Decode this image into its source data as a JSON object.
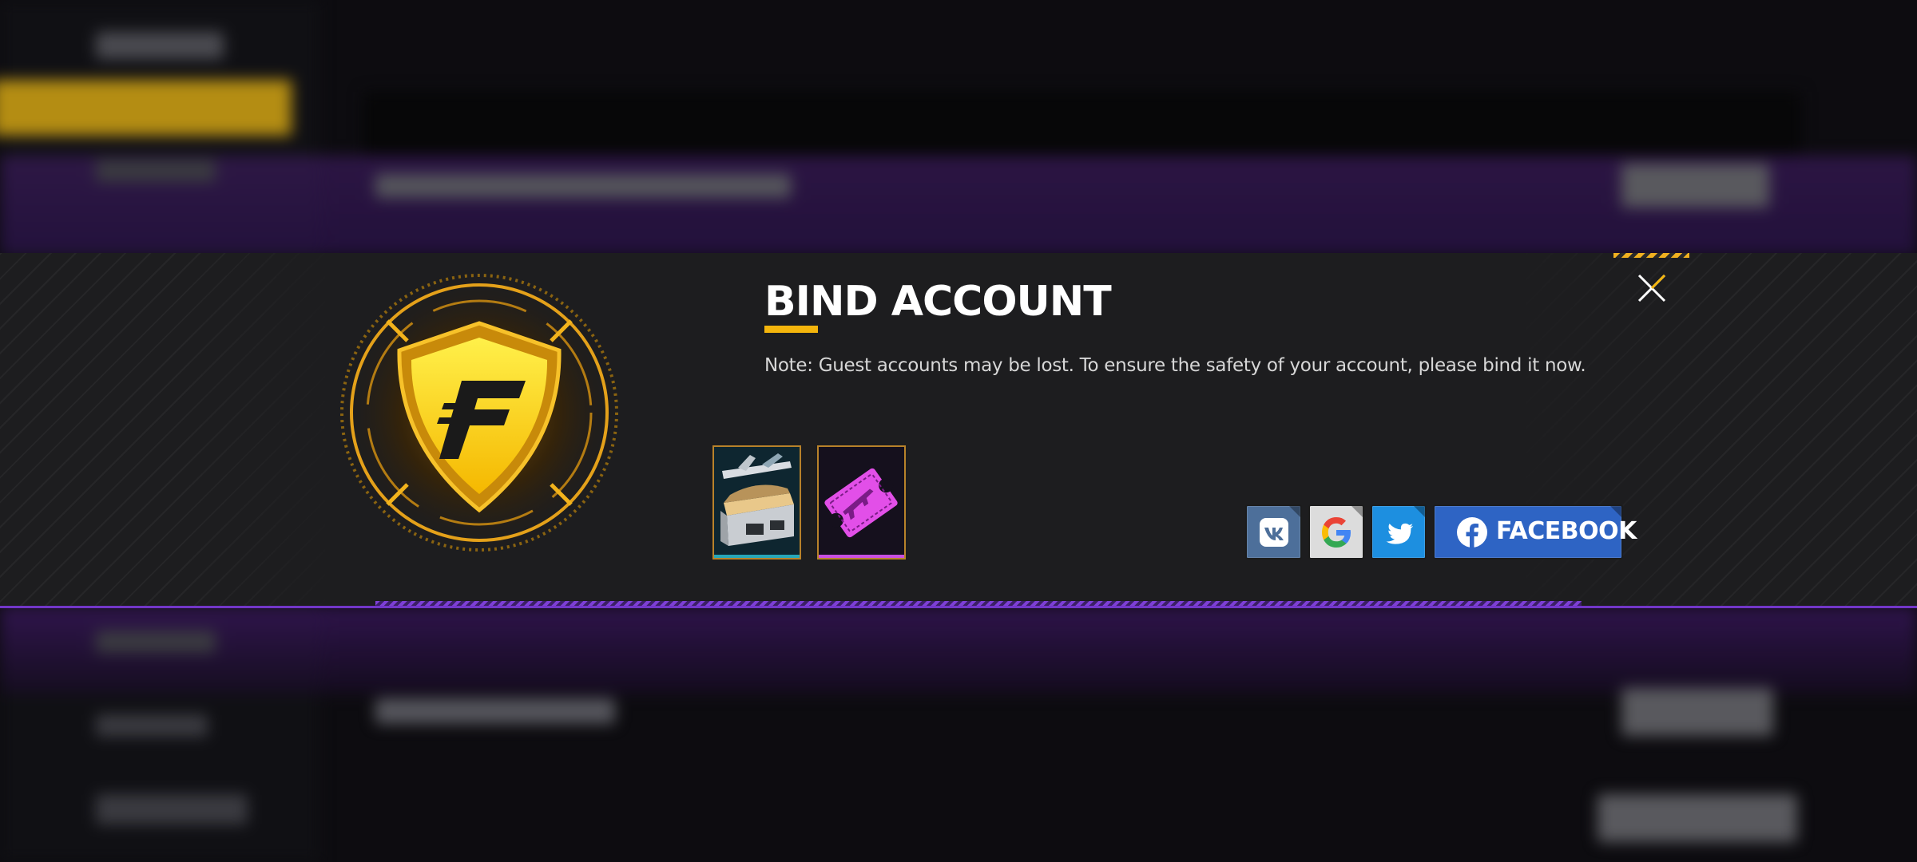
{
  "dialog": {
    "title": "BIND ACCOUNT",
    "note": "Note: Guest accounts may be lost. To ensure the safety of your account, please bind it now.",
    "emblem_letter": "F",
    "rewards": [
      {
        "name": "weapon-crate",
        "icon": "crate-with-rifle-icon"
      },
      {
        "name": "weapon-voucher",
        "icon": "pink-gun-ticket-icon"
      }
    ],
    "bind_options": [
      {
        "id": "vk",
        "icon": "vk-logo-icon"
      },
      {
        "id": "google",
        "icon": "google-logo-icon"
      },
      {
        "id": "twitter",
        "icon": "twitter-bird-icon"
      },
      {
        "id": "facebook",
        "icon": "facebook-logo-icon",
        "label": "FACEBOOK"
      }
    ],
    "close_icon": "close-icon"
  },
  "colors": {
    "accent_gold": "#f4b50c",
    "accent_purple": "#7236c9",
    "panel_bg": "#1d1d1f",
    "vk": "#4d6f9a",
    "google_bg": "#dcdcdc",
    "twitter": "#1d8fe0",
    "facebook": "#2e64c4",
    "ticket_pink": "#e24fe8"
  }
}
